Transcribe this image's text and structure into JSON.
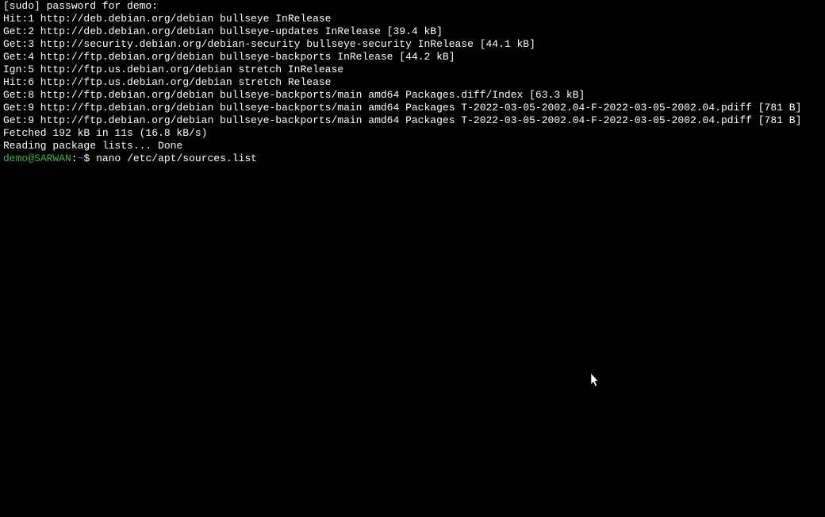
{
  "terminal": {
    "lines": [
      "[sudo] password for demo:",
      "Hit:1 http://deb.debian.org/debian bullseye InRelease",
      "Get:2 http://deb.debian.org/debian bullseye-updates InRelease [39.4 kB]",
      "Get:3 http://security.debian.org/debian-security bullseye-security InRelease [44.1 kB]",
      "Get:4 http://ftp.debian.org/debian bullseye-backports InRelease [44.2 kB]",
      "Ign:5 http://ftp.us.debian.org/debian stretch InRelease",
      "Hit:6 http://ftp.us.debian.org/debian stretch Release",
      "Get:8 http://ftp.debian.org/debian bullseye-backports/main amd64 Packages.diff/Index [63.3 kB]",
      "Get:9 http://ftp.debian.org/debian bullseye-backports/main amd64 Packages T-2022-03-05-2002.04-F-2022-03-05-2002.04.pdiff [781 B]",
      "Get:9 http://ftp.debian.org/debian bullseye-backports/main amd64 Packages T-2022-03-05-2002.04-F-2022-03-05-2002.04.pdiff [781 B]",
      "Fetched 192 kB in 11s (16.8 kB/s)",
      "Reading package lists... Done"
    ],
    "prompt": {
      "user": "demo",
      "at": "@",
      "host": "SARWAN",
      "colon": ":",
      "path": "~",
      "dollar": "$",
      "command": " nano /etc/apt/sources.list"
    }
  }
}
